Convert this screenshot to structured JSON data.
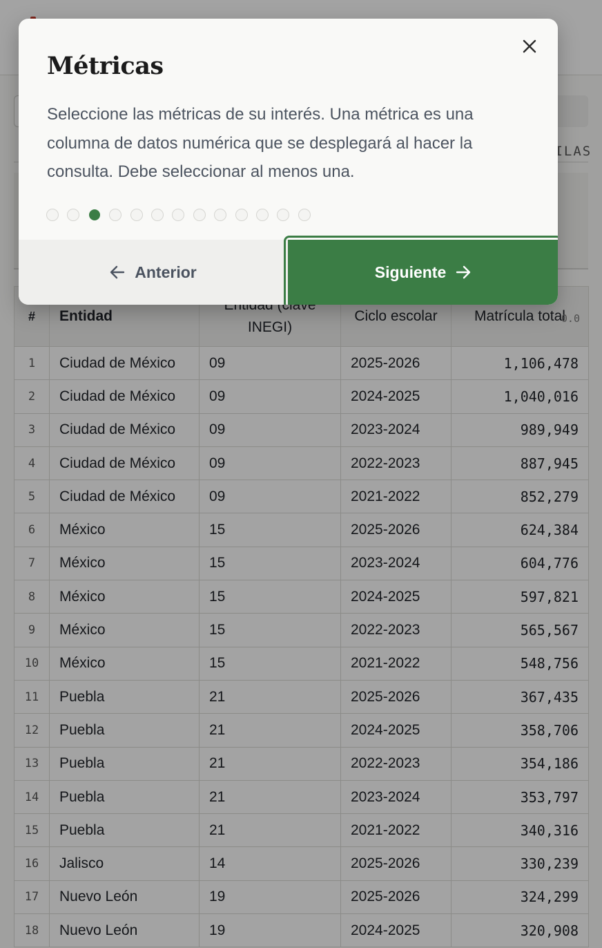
{
  "dialog": {
    "title": "Métricas",
    "description": "Seleccione las métricas de su interés. Una métrica es una columna de datos numérica que se desplegará al hacer la consulta. Debe seleccionar al menos una.",
    "step_count": 13,
    "active_step": 3,
    "prev_label": "Anterior",
    "next_label": "Siguiente",
    "close_icon": "close-icon",
    "accent_color": "#3b7d45"
  },
  "background": {
    "tab_label": "FILAS"
  },
  "table": {
    "headers": {
      "index": "#",
      "entidad": "Entidad",
      "clave": "Entidad (clave INEGI)",
      "ciclo": "Ciclo escolar",
      "matricula": "Matrícula total",
      "matricula_tag": "0.0"
    },
    "rows": [
      {
        "n": "1",
        "entidad": "Ciudad de México",
        "clave": "09",
        "ciclo": "2025-2026",
        "matricula": "1,106,478"
      },
      {
        "n": "2",
        "entidad": "Ciudad de México",
        "clave": "09",
        "ciclo": "2024-2025",
        "matricula": "1,040,016"
      },
      {
        "n": "3",
        "entidad": "Ciudad de México",
        "clave": "09",
        "ciclo": "2023-2024",
        "matricula": "989,949"
      },
      {
        "n": "4",
        "entidad": "Ciudad de México",
        "clave": "09",
        "ciclo": "2022-2023",
        "matricula": "887,945"
      },
      {
        "n": "5",
        "entidad": "Ciudad de México",
        "clave": "09",
        "ciclo": "2021-2022",
        "matricula": "852,279"
      },
      {
        "n": "6",
        "entidad": "México",
        "clave": "15",
        "ciclo": "2025-2026",
        "matricula": "624,384"
      },
      {
        "n": "7",
        "entidad": "México",
        "clave": "15",
        "ciclo": "2023-2024",
        "matricula": "604,776"
      },
      {
        "n": "8",
        "entidad": "México",
        "clave": "15",
        "ciclo": "2024-2025",
        "matricula": "597,821"
      },
      {
        "n": "9",
        "entidad": "México",
        "clave": "15",
        "ciclo": "2022-2023",
        "matricula": "565,567"
      },
      {
        "n": "10",
        "entidad": "México",
        "clave": "15",
        "ciclo": "2021-2022",
        "matricula": "548,756"
      },
      {
        "n": "11",
        "entidad": "Puebla",
        "clave": "21",
        "ciclo": "2025-2026",
        "matricula": "367,435"
      },
      {
        "n": "12",
        "entidad": "Puebla",
        "clave": "21",
        "ciclo": "2024-2025",
        "matricula": "358,706"
      },
      {
        "n": "13",
        "entidad": "Puebla",
        "clave": "21",
        "ciclo": "2022-2023",
        "matricula": "354,186"
      },
      {
        "n": "14",
        "entidad": "Puebla",
        "clave": "21",
        "ciclo": "2023-2024",
        "matricula": "353,797"
      },
      {
        "n": "15",
        "entidad": "Puebla",
        "clave": "21",
        "ciclo": "2021-2022",
        "matricula": "340,316"
      },
      {
        "n": "16",
        "entidad": "Jalisco",
        "clave": "14",
        "ciclo": "2025-2026",
        "matricula": "330,239"
      },
      {
        "n": "17",
        "entidad": "Nuevo León",
        "clave": "19",
        "ciclo": "2025-2026",
        "matricula": "324,299"
      },
      {
        "n": "18",
        "entidad": "Nuevo León",
        "clave": "19",
        "ciclo": "2024-2025",
        "matricula": "320,908"
      }
    ]
  }
}
